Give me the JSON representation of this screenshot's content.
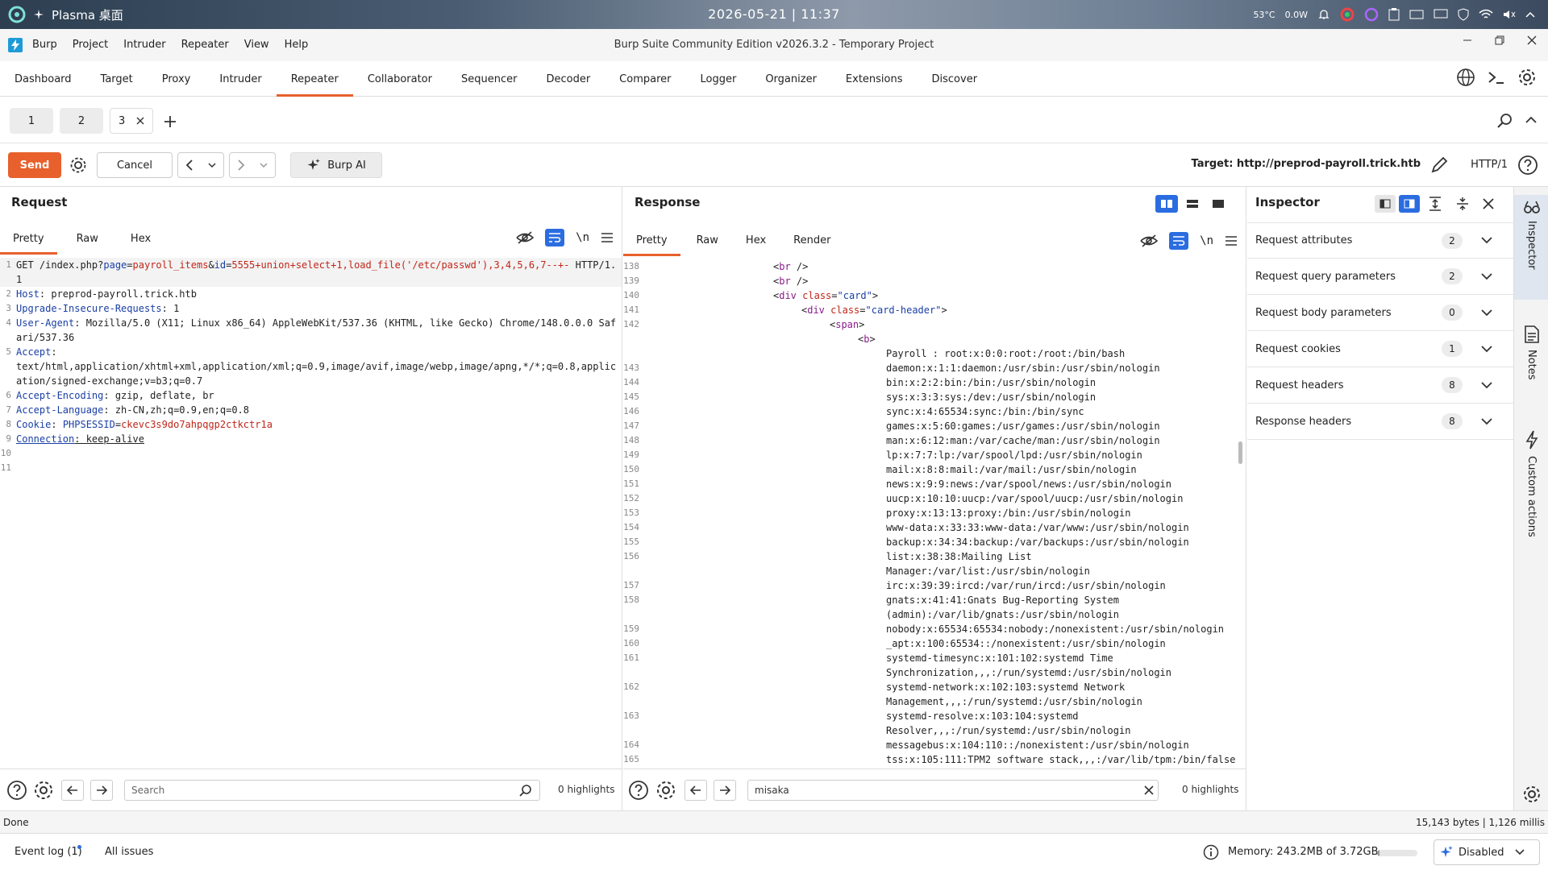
{
  "taskbar": {
    "app": "Plasma 桌面",
    "clock": "2026-05-21 | 11:37",
    "temp": "53°C",
    "power": "0.0W"
  },
  "window": {
    "title": "Burp Suite Community Edition v2026.3.2 - Temporary Project",
    "menus": [
      "Burp",
      "Project",
      "Intruder",
      "Repeater",
      "View",
      "Help"
    ]
  },
  "main_tabs": [
    "Dashboard",
    "Target",
    "Proxy",
    "Intruder",
    "Repeater",
    "Collaborator",
    "Sequencer",
    "Decoder",
    "Comparer",
    "Logger",
    "Organizer",
    "Extensions",
    "Discover"
  ],
  "sub_tabs": [
    "1",
    "2",
    "3"
  ],
  "toolbar": {
    "send": "Send",
    "cancel": "Cancel",
    "burp_ai": "Burp AI",
    "target": "Target: http://preprod-payroll.trick.htb",
    "http": "HTTP/1"
  },
  "request": {
    "title": "Request",
    "tabs": [
      "Pretty",
      "Raw",
      "Hex"
    ],
    "search_placeholder": "Search",
    "highlights": "0 highlights"
  },
  "response": {
    "title": "Response",
    "tabs": [
      "Pretty",
      "Raw",
      "Hex",
      "Render"
    ],
    "search_value": "misaka",
    "highlights": "0 highlights"
  },
  "inspector": {
    "title": "Inspector",
    "rows": [
      {
        "label": "Request attributes",
        "count": "2"
      },
      {
        "label": "Request query parameters",
        "count": "2"
      },
      {
        "label": "Request body parameters",
        "count": "0"
      },
      {
        "label": "Request cookies",
        "count": "1"
      },
      {
        "label": "Request headers",
        "count": "8"
      },
      {
        "label": "Response headers",
        "count": "8"
      }
    ]
  },
  "sidebar": [
    "Inspector",
    "Notes",
    "Custom actions"
  ],
  "status": {
    "left": "Done",
    "right": "15,143 bytes | 1,126 millis"
  },
  "footer": {
    "event_log": "Event log (1)",
    "issues": "All issues",
    "memory": "Memory: 243.2MB of 3.72GB",
    "memory_fraction": 0.065,
    "ai": "Disabled"
  }
}
